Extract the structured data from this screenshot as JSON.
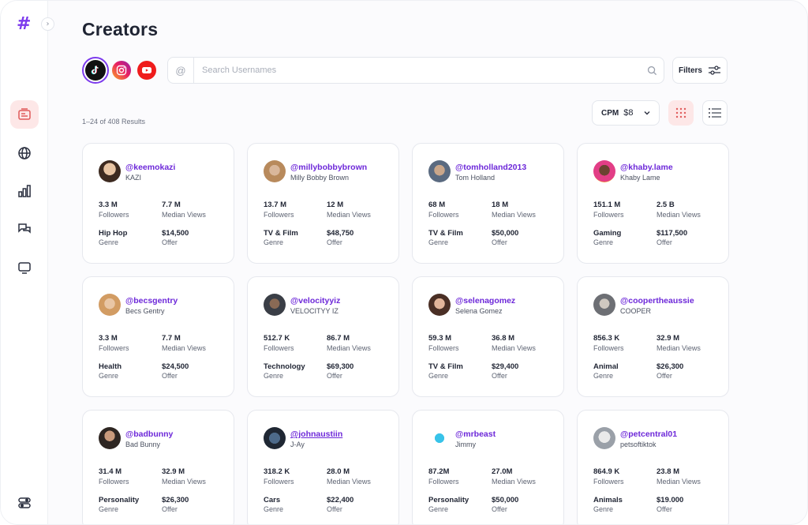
{
  "app": {
    "logo": "#"
  },
  "page": {
    "title": "Creators"
  },
  "platforms": [
    "tiktok",
    "instagram",
    "youtube"
  ],
  "search": {
    "at": "@",
    "placeholder": "Search Usernames",
    "value": ""
  },
  "filters": {
    "label": "Filters"
  },
  "results": {
    "text": "1–24 of 408 Results"
  },
  "cpm": {
    "label": "CPM",
    "value": "$8"
  },
  "labels": {
    "followers": "Followers",
    "median_views": "Median Views",
    "genre": "Genre",
    "offer": "Offer"
  },
  "creators": [
    {
      "handle": "@keemokazi",
      "name": "KAZI",
      "followers": "3.3 M",
      "views": "7.7 M",
      "genre": "Hip Hop",
      "offer": "$14,500"
    },
    {
      "handle": "@millybobbybrown",
      "name": "Milly Bobby Brown",
      "followers": "13.7 M",
      "views": "12 M",
      "genre": "TV & Film",
      "offer": "$48,750"
    },
    {
      "handle": "@tomholland2013",
      "name": "Tom Holland",
      "followers": "68 M",
      "views": "18 M",
      "genre": "TV & Film",
      "offer": "$50,000"
    },
    {
      "handle": "@khaby.lame",
      "name": "Khaby Lame",
      "followers": "151.1 M",
      "views": "2.5 B",
      "genre": "Gaming",
      "offer": "$117,500"
    },
    {
      "handle": "@becsgentry",
      "name": "Becs Gentry",
      "followers": "3.3 M",
      "views": "7.7 M",
      "genre": "Health",
      "offer": "$24,500"
    },
    {
      "handle": "@velocityyiz",
      "name": "VELOCITYY IZ",
      "followers": "512.7 K",
      "views": "86.7 M",
      "genre": "Technology",
      "offer": "$69,300"
    },
    {
      "handle": "@selenagomez",
      "name": "Selena Gomez",
      "followers": "59.3 M",
      "views": "36.8 M",
      "genre": "TV & Film",
      "offer": "$29,400"
    },
    {
      "handle": "@coopertheaussie",
      "name": "COOPER",
      "followers": "856.3 K",
      "views": "32.9 M",
      "genre": "Animal",
      "offer": "$26,300"
    },
    {
      "handle": "@badbunny",
      "name": "Bad Bunny",
      "followers": "31.4 M",
      "views": "32.9 M",
      "genre": "Personality",
      "offer": "$26,300"
    },
    {
      "handle": "@johnaustiin",
      "name": "J-Ay",
      "followers": "318.2 K",
      "views": "28.0 M",
      "genre": "Cars",
      "offer": "$22,400"
    },
    {
      "handle": "@mrbeast",
      "name": "Jimmy",
      "followers": "87.2M",
      "views": "27.0M",
      "genre": "Personality",
      "offer": "$50,000"
    },
    {
      "handle": "@petcentral01",
      "name": "petsoftiktok",
      "followers": "864.9 K",
      "views": "23.8 M",
      "genre": "Animals",
      "offer": "$19.000"
    }
  ],
  "colors": {
    "accent": "#6d28d9",
    "active_bg": "#fde7e7",
    "active_icon": "#e05a5a"
  }
}
